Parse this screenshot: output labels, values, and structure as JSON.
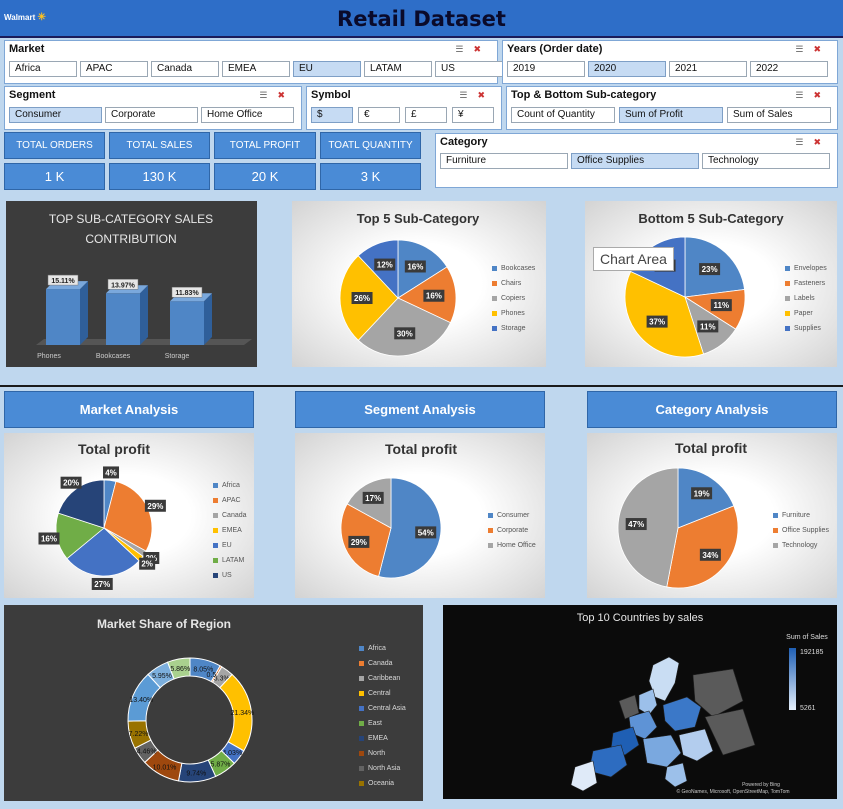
{
  "header": {
    "title": "Retail Dataset",
    "logo": "Walmart"
  },
  "slicers": {
    "market": {
      "title": "Market",
      "options": [
        "Africa",
        "APAC",
        "Canada",
        "EMEA",
        "EU",
        "LATAM",
        "US"
      ],
      "selected": "EU"
    },
    "years": {
      "title": "Years (Order date)",
      "options": [
        "2019",
        "2020",
        "2021",
        "2022"
      ],
      "selected": "2020"
    },
    "segment": {
      "title": "Segment",
      "options": [
        "Consumer",
        "Corporate",
        "Home Office"
      ],
      "selected": "Consumer"
    },
    "symbol": {
      "title": "Symbol",
      "options": [
        "$",
        "€",
        "£",
        "¥"
      ],
      "selected": "$"
    },
    "topbottom": {
      "title": "Top & Bottom Sub-category",
      "options": [
        "Count of Quantity",
        "Sum of Profit",
        "Sum of Sales"
      ],
      "selected": "Sum of Profit"
    },
    "category": {
      "title": "Category",
      "options": [
        "Furniture",
        "Office Supplies",
        "Technology"
      ],
      "selected": "Office Supplies"
    }
  },
  "kpis": [
    {
      "label": "TOTAL ORDERS",
      "value": "1 K"
    },
    {
      "label": "TOTAL SALES",
      "value": "130 K"
    },
    {
      "label": "TOTAL PROFIT",
      "value": "20 K"
    },
    {
      "label": "TOATL QUANTITY",
      "value": "3 K"
    }
  ],
  "sections": {
    "market": "Market Analysis",
    "segment": "Segment Analysis",
    "category": "Category Analysis"
  },
  "tooltip": "Chart Area",
  "map": {
    "attribution_powered": "Powered by Bing",
    "attribution": "© GeoNames, Microsoft, OpenStreetMap, TomTom"
  },
  "colors": {
    "blue": "#4f86c6",
    "orange": "#ed7d31",
    "gray": "#a5a5a5",
    "yellow": "#ffc000",
    "darkblue": "#4472c4",
    "green": "#70ad47",
    "navy": "#264478",
    "brown": "#9e480e"
  },
  "chart_data": [
    {
      "id": "topsub",
      "type": "bar",
      "title": "TOP SUB-CATEGORY SALES CONTRIBUTION",
      "categories": [
        "Phones",
        "Bookcases",
        "Storage"
      ],
      "values": [
        15.11,
        13.97,
        11.83
      ],
      "labels": [
        "15.11%",
        "13.97%",
        "11.83%"
      ],
      "ylim": [
        0,
        20
      ]
    },
    {
      "id": "top5",
      "type": "pie",
      "title": "Top 5 Sub-Category",
      "categories": [
        "Bookcases",
        "Chairs",
        "Copiers",
        "Phones",
        "Storage"
      ],
      "values": [
        16,
        16,
        30,
        26,
        12
      ],
      "labels": [
        "16%",
        "16%",
        "30%",
        "26%",
        "12%"
      ]
    },
    {
      "id": "bottom5",
      "type": "pie",
      "title": "Bottom 5 Sub-Category",
      "categories": [
        "Envelopes",
        "Fasteners",
        "Labels",
        "Paper",
        "Supplies"
      ],
      "values": [
        23,
        11,
        11,
        37,
        18
      ],
      "labels": [
        "23%",
        "11%",
        "11%",
        "37%",
        "18%"
      ]
    },
    {
      "id": "market",
      "type": "pie",
      "title": "Total profit",
      "categories": [
        "Africa",
        "APAC",
        "Canada",
        "EMEA",
        "EU",
        "LATAM",
        "US"
      ],
      "values": [
        4,
        29,
        2,
        2,
        27,
        16,
        20
      ],
      "labels": [
        "4%",
        "29%",
        "2%",
        "2%",
        "27%",
        "16%",
        "20%"
      ]
    },
    {
      "id": "segment",
      "type": "pie",
      "title": "Total profit",
      "categories": [
        "Consumer",
        "Corporate",
        "Home Office"
      ],
      "values": [
        54,
        29,
        17
      ],
      "labels": [
        "54%",
        "29%",
        "17%"
      ]
    },
    {
      "id": "category",
      "type": "pie",
      "title": "Total profit",
      "categories": [
        "Furniture",
        "Office Supplies",
        "Technology"
      ],
      "values": [
        19,
        34,
        47
      ],
      "labels": [
        "19%",
        "34%",
        "47%"
      ]
    },
    {
      "id": "region",
      "type": "pie",
      "donut": true,
      "title": "Market Share of Region",
      "categories": [
        "Africa",
        "Canada",
        "Caribbean",
        "Central",
        "Central Asia",
        "East",
        "EMEA",
        "North",
        "North Asia",
        "Oceania"
      ],
      "values": [
        8.05,
        0.51,
        3.3,
        21.34,
        4.03,
        5.87,
        9.74,
        10.01,
        4.46,
        7.22,
        13.4,
        5.95,
        5.86
      ],
      "labels": [
        "8.05%",
        "0.51%",
        "3.3%",
        "21.34%",
        "4.03%",
        "5.87%",
        "9.74%",
        "10.01%",
        "4.46%",
        "7.22%",
        "13.40%",
        "5.95%",
        "5.86%"
      ]
    },
    {
      "id": "countries",
      "type": "map",
      "title": "Top 10 Countries by sales",
      "legend_title": "Sum of Sales",
      "scale_max": 192185,
      "scale_min": 5261,
      "scale_max_label": "192185",
      "scale_min_label": "5261"
    }
  ]
}
